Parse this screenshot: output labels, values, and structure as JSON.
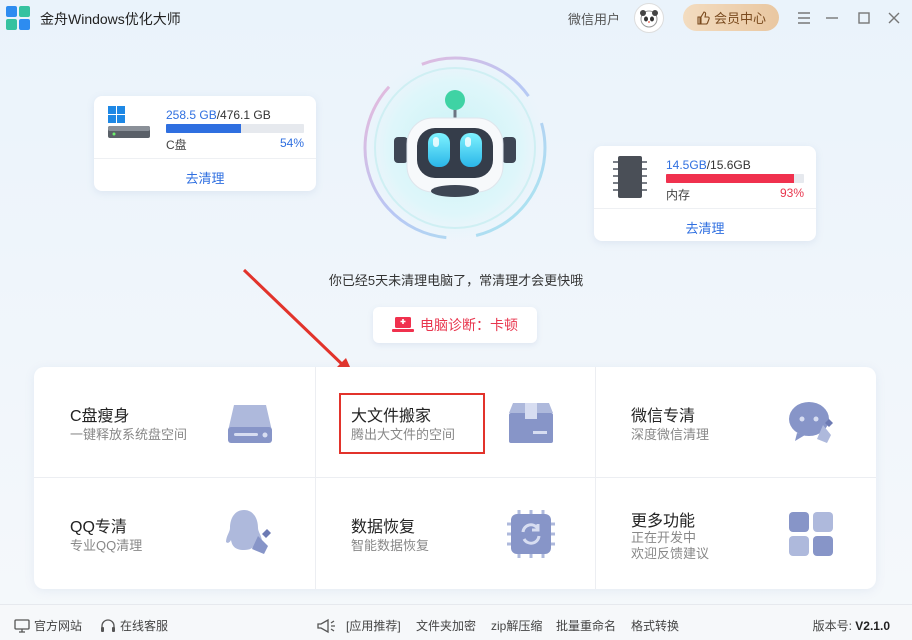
{
  "titlebar": {
    "app_title": "金舟Windows优化大师",
    "user_name": "微信用户",
    "vip_label": "会员中心"
  },
  "disk_c": {
    "used": "258.5 GB",
    "total": "/476.1 GB",
    "label": "C盘",
    "percent": "54%",
    "fill_fraction": 0.54,
    "action": "去清理"
  },
  "memory": {
    "used": "14.5GB",
    "total": "/15.6GB",
    "label": "内存",
    "percent": "93%",
    "fill_fraction": 0.93,
    "action": "去清理"
  },
  "hint": "你已经5天未清理电脑了，常清理才会更快哦",
  "diagnosis": "电脑诊断：卡顿",
  "features": [
    {
      "title": "C盘瘦身",
      "subtitle": "一键释放系统盘空间",
      "icon": "disk-icon"
    },
    {
      "title": "大文件搬家",
      "subtitle": "腾出大文件的空间",
      "icon": "box-icon"
    },
    {
      "title": "微信专清",
      "subtitle": "深度微信清理",
      "icon": "wechat-clean-icon"
    },
    {
      "title": "QQ专清",
      "subtitle": "专业QQ清理",
      "icon": "qq-clean-icon"
    },
    {
      "title": "数据恢复",
      "subtitle": "智能数据恢复",
      "icon": "recover-icon"
    },
    {
      "title": "更多功能",
      "subtitle": "正在开发中",
      "subtitle2": "欢迎反馈建议",
      "icon": "grid-icon"
    }
  ],
  "footer": {
    "website": "官方网站",
    "service": "在线客服",
    "recommend": "[应用推荐]",
    "encrypt": "文件夹加密",
    "zip": "zip解压缩",
    "rename": "批量重命名",
    "convert": "格式转换",
    "version_label": "版本号:",
    "version": "V2.1.0"
  },
  "colors": {
    "accent": "#2f6fe0",
    "danger": "#e8364e",
    "annotation": "#e2332b"
  }
}
